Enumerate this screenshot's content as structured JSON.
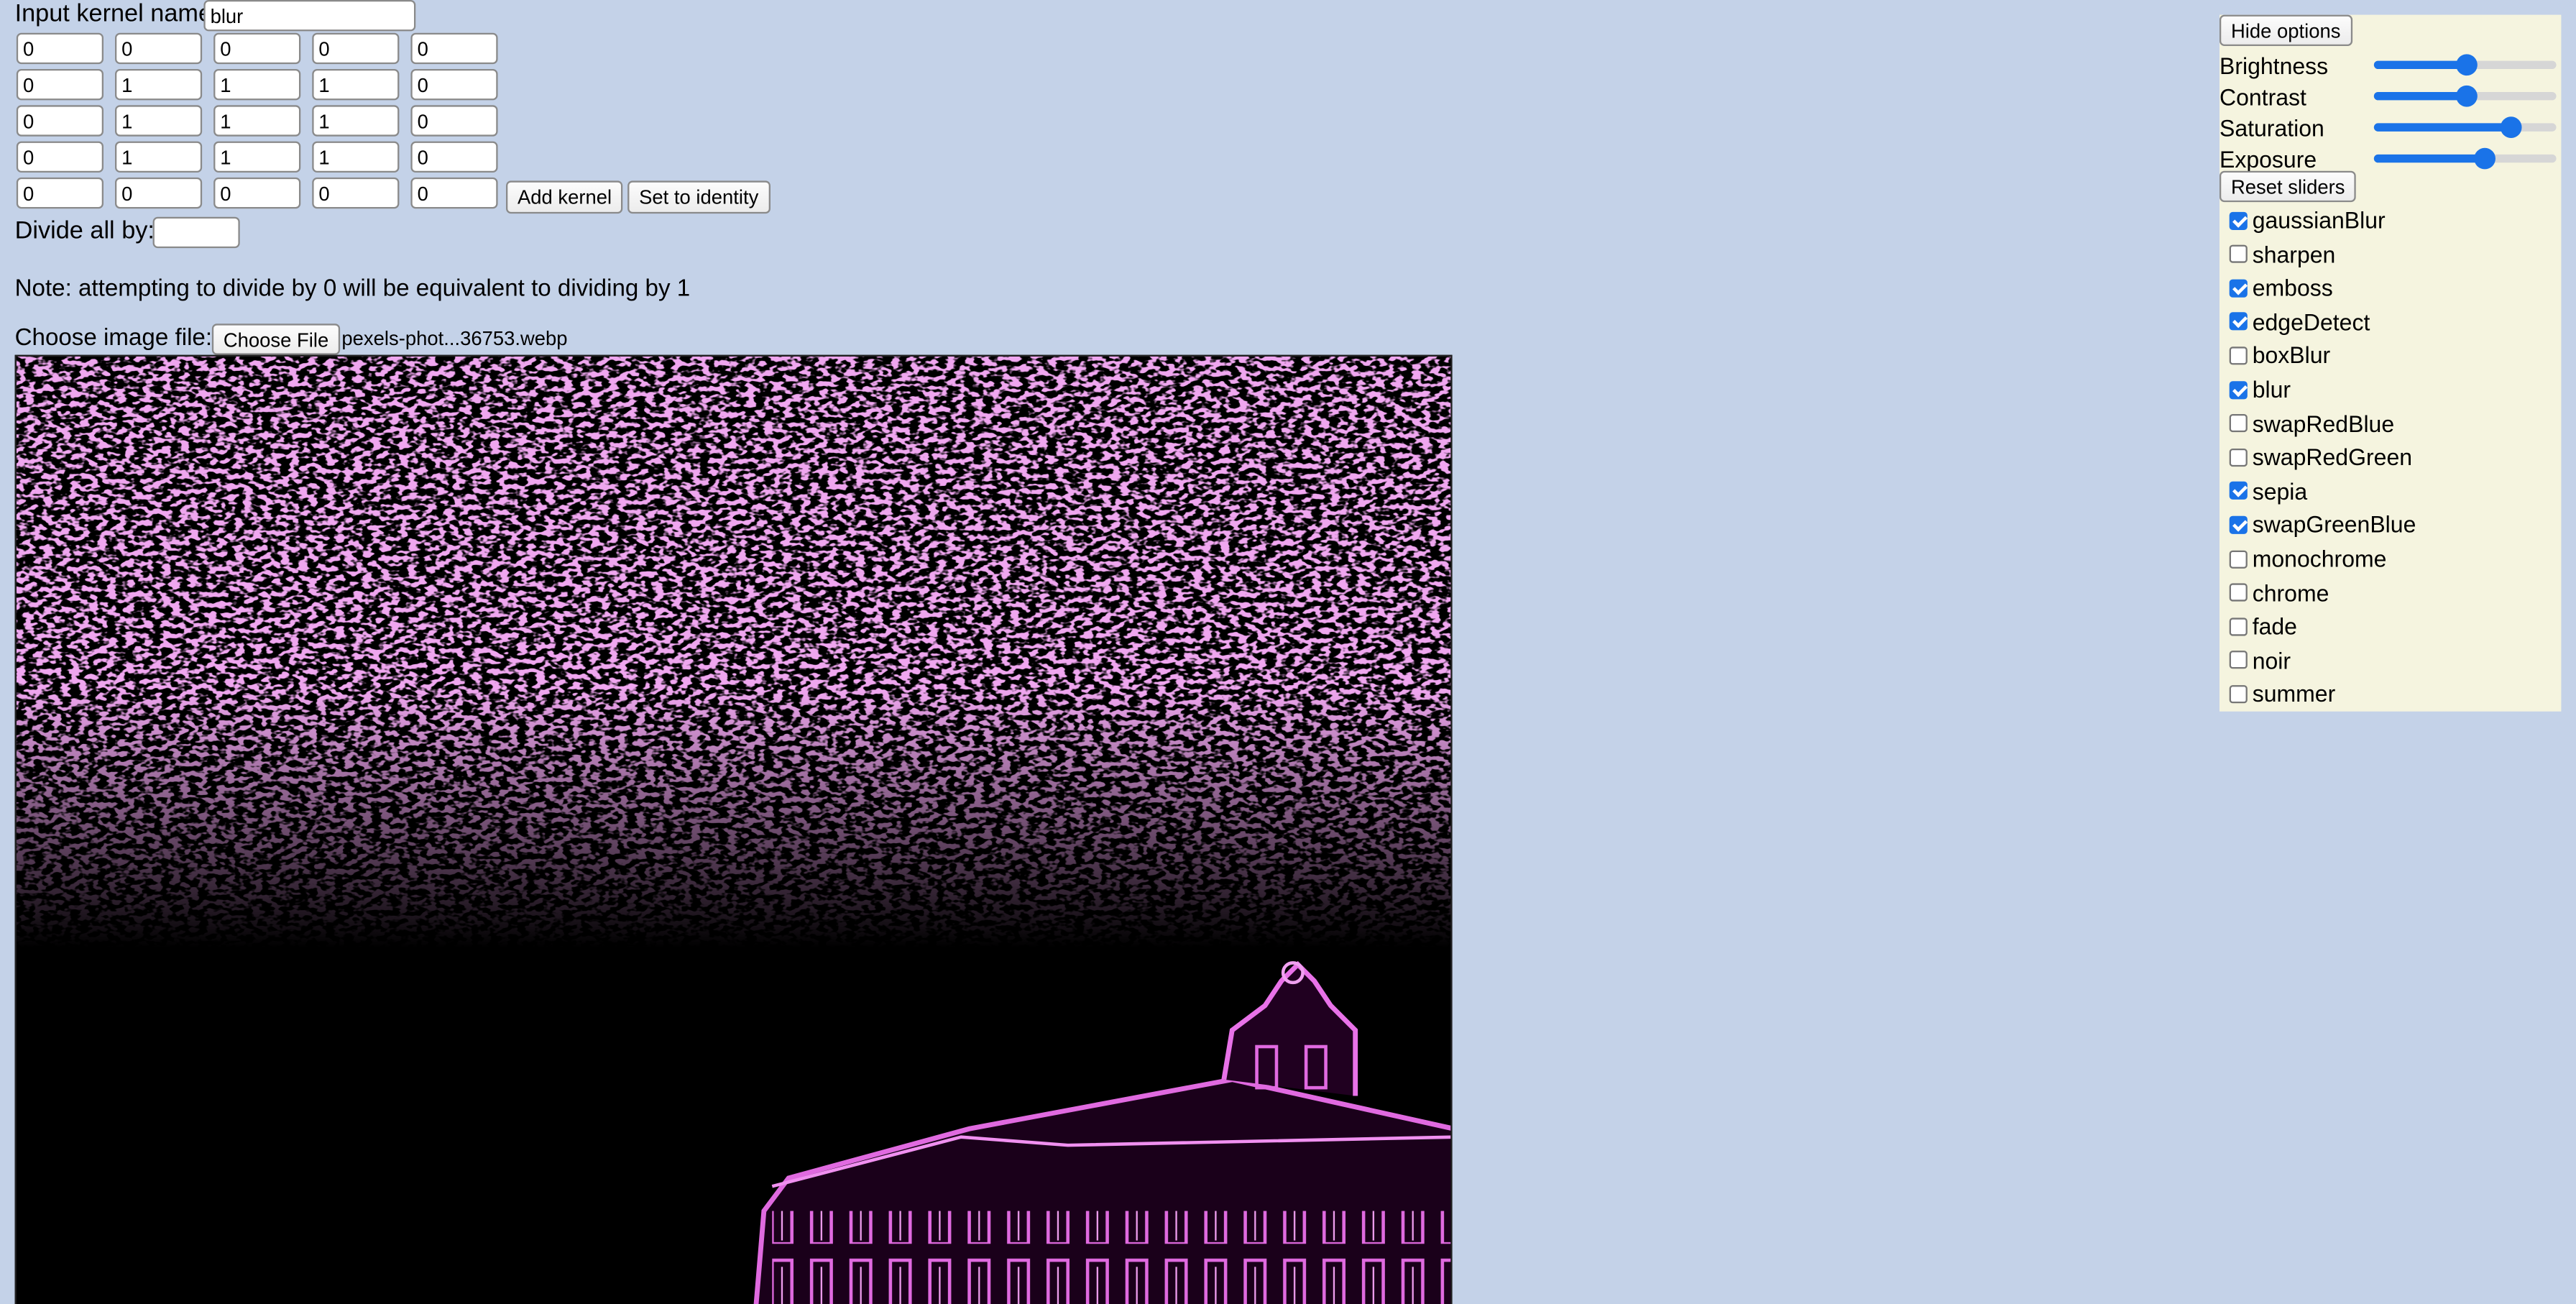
{
  "kernel": {
    "name_label": "Input kernel name",
    "name_value": "blur",
    "matrix": [
      [
        "0",
        "0",
        "0",
        "0",
        "0"
      ],
      [
        "0",
        "1",
        "1",
        "1",
        "0"
      ],
      [
        "0",
        "1",
        "1",
        "1",
        "0"
      ],
      [
        "0",
        "1",
        "1",
        "1",
        "0"
      ],
      [
        "0",
        "0",
        "0",
        "0",
        "0"
      ]
    ],
    "add_label": "Add kernel",
    "identity_label": "Set to identity",
    "divide_label": "Divide all by:",
    "divide_value": "",
    "note": "Note: attempting to divide by 0 will be equivalent to dividing by 1"
  },
  "file": {
    "label": "Choose image file:",
    "button_label": "Choose File",
    "filename": "pexels-phot...36753.webp"
  },
  "options": {
    "hide_label": "Hide options",
    "sliders": [
      {
        "label": "Brightness",
        "value": 0.5
      },
      {
        "label": "Contrast",
        "value": 0.5
      },
      {
        "label": "Saturation",
        "value": 0.75
      },
      {
        "label": "Exposure",
        "value": 0.6
      }
    ],
    "reset_label": "Reset sliders",
    "filters": [
      {
        "label": "gaussianBlur",
        "checked": true
      },
      {
        "label": "sharpen",
        "checked": false
      },
      {
        "label": "emboss",
        "checked": true
      },
      {
        "label": "edgeDetect",
        "checked": true
      },
      {
        "label": "boxBlur",
        "checked": false
      },
      {
        "label": "blur",
        "checked": true
      },
      {
        "label": "swapRedBlue",
        "checked": false
      },
      {
        "label": "swapRedGreen",
        "checked": false
      },
      {
        "label": "sepia",
        "checked": true
      },
      {
        "label": "swapGreenBlue",
        "checked": true
      },
      {
        "label": "monochrome",
        "checked": false
      },
      {
        "label": "chrome",
        "checked": false
      },
      {
        "label": "fade",
        "checked": false
      },
      {
        "label": "noir",
        "checked": false
      },
      {
        "label": "summer",
        "checked": false
      }
    ]
  },
  "colors": {
    "page_bg": "#c4d2e8",
    "panel_bg": "#f5f4df",
    "accent": "#1a73e8",
    "image_tint": "#d04fcf"
  }
}
